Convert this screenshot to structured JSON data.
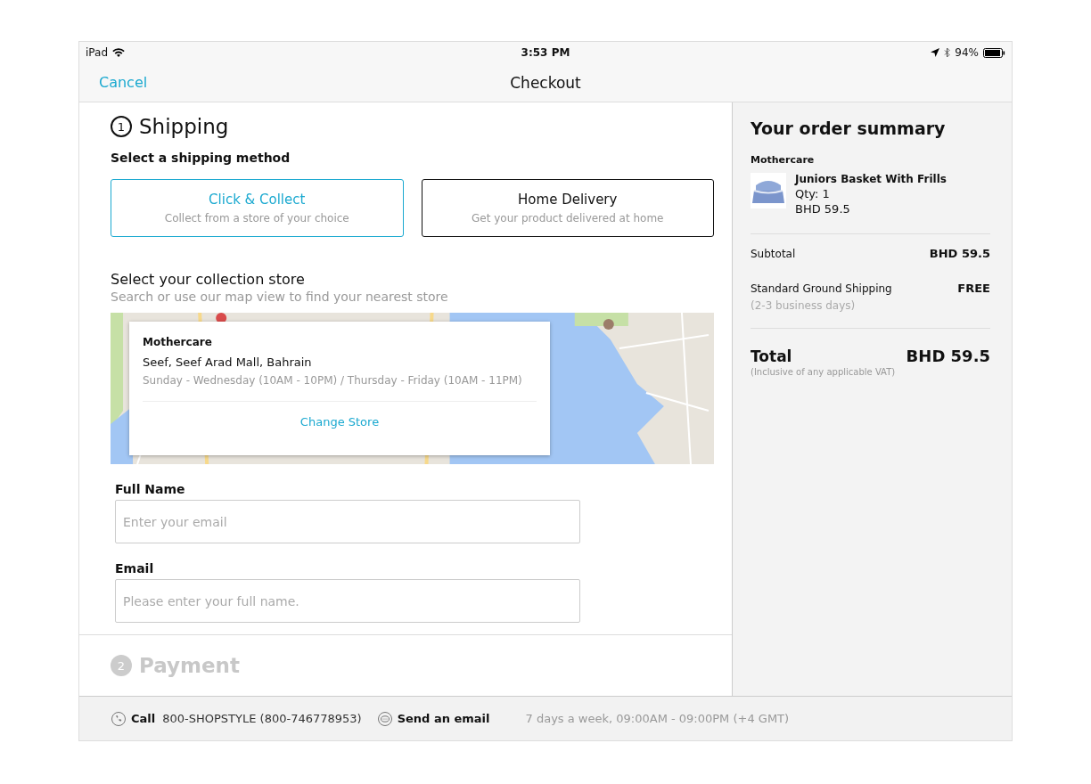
{
  "status_bar": {
    "device": "iPad",
    "time": "3:53 PM",
    "battery": "94%"
  },
  "nav_bar": {
    "left": "Cancel",
    "title": "Checkout"
  },
  "steps": [
    {
      "number": "1",
      "title": "Shipping",
      "active": true
    },
    {
      "number": "2",
      "title": "Payment",
      "active": false
    }
  ],
  "shipping": {
    "heading": "Select a shipping method",
    "methods": [
      {
        "title": "Click & Collect",
        "subtitle": "Collect from a store of your choice",
        "selected": true
      },
      {
        "title": "Home Delivery",
        "subtitle": "Get your product delivered at home",
        "selected": false
      }
    ],
    "store_heading": "Select your collection store",
    "store_hint": "Search or use our map view to find your nearest store",
    "store_card": {
      "name": "Mothercare",
      "address": "Seef, Seef Arad Mall, Bahrain",
      "hours": "Sunday - Wednesday (10AM - 10PM) / Thursday - Friday (10AM - 11PM)",
      "action": "Change Store"
    },
    "fields": [
      {
        "label": "Full Name",
        "placeholder": "Enter your email"
      },
      {
        "label": "Email",
        "placeholder": "Please enter your full name."
      }
    ]
  },
  "order_summary": {
    "title": "Your order summary",
    "seller": "Mothercare",
    "items": [
      {
        "name": "Juniors Basket With Frills",
        "qty": "Qty: 1",
        "price": "BHD 59.5"
      }
    ],
    "lines": [
      {
        "label": "Subtotal",
        "value": "BHD 59.5"
      },
      {
        "label": "Standard Ground Shipping",
        "value": "FREE",
        "note": "(2-3 business days)"
      }
    ],
    "total": {
      "label": "Total",
      "value": "BHD 59.5",
      "note": "(Inclusive of any applicable VAT)"
    }
  },
  "footer": {
    "call_label": "Call",
    "phone": "800-SHOPSTYLE (800-746778953)",
    "email_label": "Send an email",
    "hours": "7 days a week, 09:00AM - 09:00PM (+4 GMT)"
  }
}
